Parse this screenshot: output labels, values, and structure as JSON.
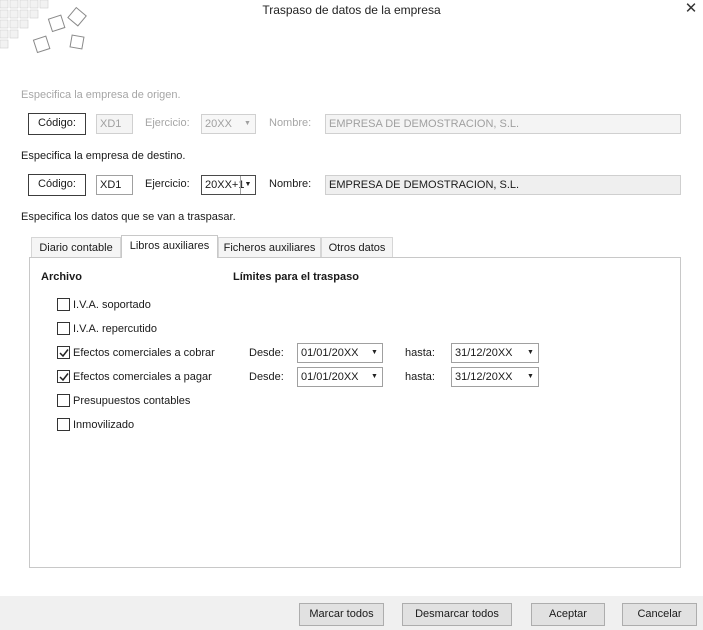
{
  "window": {
    "title": "Traspaso de datos de la empresa",
    "close_glyph": "✕"
  },
  "origen": {
    "label": "Especifica la empresa de origen.",
    "codigo_button": "Código:",
    "codigo_value": "XD1",
    "ejercicio_label": "Ejercicio:",
    "ejercicio_value": "20XX",
    "nombre_label": "Nombre:",
    "nombre_value": "EMPRESA DE DEMOSTRACION, S.L."
  },
  "destino": {
    "label": "Especifica la empresa de destino.",
    "codigo_button": "Código:",
    "codigo_value": "XD1",
    "ejercicio_label": "Ejercicio:",
    "ejercicio_value": "20XX+1",
    "nombre_label": "Nombre:",
    "nombre_value": "EMPRESA DE DEMOSTRACION, S.L."
  },
  "datos_label": "Especifica los datos que se van a traspasar.",
  "tabs": [
    {
      "label": "Diario contable",
      "active": false
    },
    {
      "label": "Libros auxiliares",
      "active": true
    },
    {
      "label": "Ficheros auxiliares",
      "active": false
    },
    {
      "label": "Otros datos",
      "active": false
    }
  ],
  "panel": {
    "archivo_header": "Archivo",
    "limites_header": "Límites para el traspaso",
    "desde_label": "Desde:",
    "hasta_label": "hasta:",
    "items": [
      {
        "label": "I.V.A. soportado",
        "checked": false
      },
      {
        "label": "I.V.A. repercutido",
        "checked": false
      },
      {
        "label": "Efectos comerciales a cobrar",
        "checked": true,
        "desde": "01/01/20XX",
        "hasta": "31/12/20XX"
      },
      {
        "label": "Efectos comerciales a pagar",
        "checked": true,
        "desde": "01/01/20XX",
        "hasta": "31/12/20XX"
      },
      {
        "label": "Presupuestos contables",
        "checked": false
      },
      {
        "label": "Inmovilizado",
        "checked": false
      }
    ]
  },
  "footer": {
    "marcar_todos": "Marcar todos",
    "desmarcar_todos": "Desmarcar todos",
    "aceptar": "Aceptar",
    "cancelar": "Cancelar"
  },
  "icons": {
    "dropdown": "chevron-down-icon",
    "check": "checkmark-icon",
    "close": "close-icon",
    "logo": "tiles-logo-icon"
  }
}
